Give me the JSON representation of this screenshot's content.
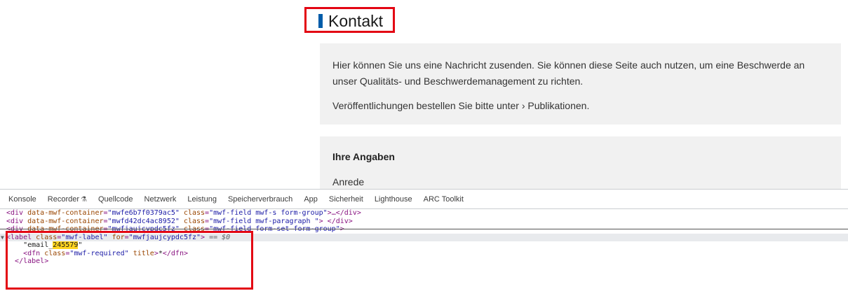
{
  "page": {
    "heading": "Kontakt",
    "intro": {
      "p1": "Hier können Sie uns eine Nachricht zusenden. Sie können diese Seite auch nutzen, um eine Beschwerde an unser Qualitäts- und Beschwerdemanagement zu richten.",
      "p2_prefix": "Veröffentlichungen bestellen Sie bitte unter ",
      "p2_link": "› Publikationen",
      "p2_suffix": "."
    },
    "form": {
      "title": "Ihre Angaben",
      "field_label": "Anrede"
    }
  },
  "devtools": {
    "tabs": [
      "Konsole",
      "Recorder",
      "Quellcode",
      "Netzwerk",
      "Leistung",
      "Speicherverbrauch",
      "App",
      "Sicherheit",
      "Lighthouse",
      "ARC Toolkit"
    ],
    "code": {
      "l1_container": "mwfe6b7f0379ac5",
      "l1_class": "mwf-field mwf-s form-group",
      "l1_tail": "…</div>",
      "l2_container": "mwfd42dc4ac8952",
      "l2_class": "mwf-field mwf-paragraph ",
      "l2_tail": " </div>",
      "l3_container": "mwfjaujcypdc5fz",
      "l3_class": "mwf-field form-set form-group",
      "l4_class": "mwf-label",
      "l4_for": "mwfjaujcypdc5fz",
      "l4_suffix": " == $0",
      "l5_text_pre": "\"email_",
      "l5_text_hl": "245579",
      "l5_text_post": "\"",
      "l6_class": "mwf-required",
      "l6_title": "",
      "l6_content": "*"
    }
  },
  "colors": {
    "highlight_border": "#e30613",
    "heading_bar": "#005ca9",
    "panel_bg": "#f1f1f1"
  }
}
